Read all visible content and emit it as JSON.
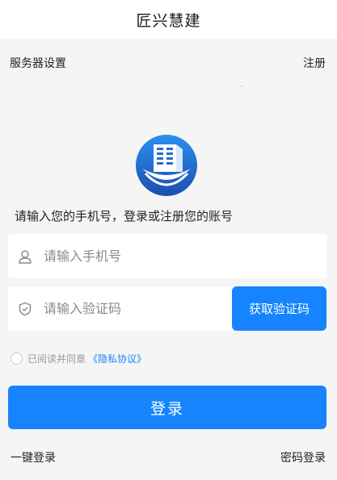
{
  "header": {
    "title": "匠兴慧建"
  },
  "top_bar": {
    "server_settings": "服务器设置",
    "register": "注册"
  },
  "prompt": "请输入您的手机号，登录或注册您的账号",
  "phone": {
    "placeholder": "请输入手机号",
    "value": ""
  },
  "code": {
    "placeholder": "请输入验证码",
    "value": "",
    "button": "获取验证码"
  },
  "agreement": {
    "text": "已阅读并同意",
    "link": "《隐私协议》",
    "checked": false
  },
  "login_button": "登录",
  "bottom": {
    "one_click": "一键登录",
    "password_login": "密码登录"
  },
  "colors": {
    "accent": "#1684ff",
    "background": "#f5f5f5",
    "logo_dark": "#1f4fa8"
  },
  "icons": {
    "phone": "user-icon",
    "code": "shield-icon",
    "logo": "building-logo-icon"
  }
}
